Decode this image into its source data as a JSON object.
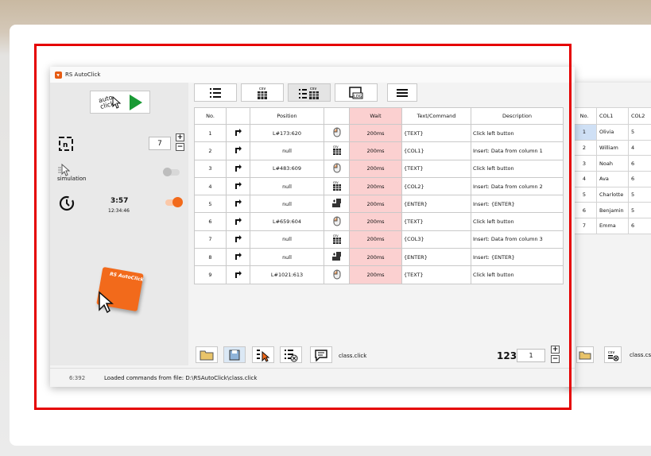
{
  "window": {
    "title": "RS AutoClick"
  },
  "left": {
    "auto_click_label": "auto click",
    "repeat_value": "7",
    "plus": "+",
    "minus": "−",
    "simulation_label": "simulation",
    "timer_value": "3:57",
    "timer_time": "12:34:46",
    "logo_text": "RS AutoClick"
  },
  "table": {
    "headers": [
      "No.",
      "",
      "Position",
      "",
      "Wait",
      "Text/Command",
      "Description"
    ],
    "rows": [
      {
        "no": "1",
        "position": "L#173:620",
        "wait": "200ms",
        "text": "{TEXT}",
        "desc": "Click left button",
        "icon": "mouse"
      },
      {
        "no": "2",
        "position": "null",
        "wait": "200ms",
        "text": "{COL1}",
        "desc": "Insert: Data from column 1",
        "icon": "csv"
      },
      {
        "no": "3",
        "position": "L#483:609",
        "wait": "200ms",
        "text": "{TEXT}",
        "desc": "Click left button",
        "icon": "mouse"
      },
      {
        "no": "4",
        "position": "null",
        "wait": "200ms",
        "text": "{COL2}",
        "desc": "Insert: Data from column 2",
        "icon": "csv"
      },
      {
        "no": "5",
        "position": "null",
        "wait": "200ms",
        "text": "{ENTER}",
        "desc": "Insert: {ENTER}",
        "icon": "key"
      },
      {
        "no": "6",
        "position": "L#659:604",
        "wait": "200ms",
        "text": "{TEXT}",
        "desc": "Click left button",
        "icon": "mouse"
      },
      {
        "no": "7",
        "position": "null",
        "wait": "200ms",
        "text": "{COL3}",
        "desc": "Insert: Data from column 3",
        "icon": "csv"
      },
      {
        "no": "8",
        "position": "null",
        "wait": "200ms",
        "text": "{ENTER}",
        "desc": "Insert: {ENTER}",
        "icon": "key"
      },
      {
        "no": "9",
        "position": "L#1021:613",
        "wait": "200ms",
        "text": "{TEXT}",
        "desc": "Click left button",
        "icon": "mouse"
      }
    ]
  },
  "bottom": {
    "filename": "class.click",
    "counter_label": "123",
    "counter_value": "1"
  },
  "status": {
    "code": "6:392",
    "message": "Loaded commands from file: D:\\RSAutoClick\\class.click"
  },
  "csv": {
    "headers": [
      "No.",
      "COL1",
      "COL2"
    ],
    "rows": [
      [
        "1",
        "Olivia",
        "5"
      ],
      [
        "2",
        "William",
        "4"
      ],
      [
        "3",
        "Noah",
        "6"
      ],
      [
        "4",
        "Ava",
        "6"
      ],
      [
        "5",
        "Charlotte",
        "5"
      ],
      [
        "6",
        "Benjamin",
        "5"
      ],
      [
        "7",
        "Emma",
        "6"
      ]
    ],
    "filename": "class.csv"
  }
}
